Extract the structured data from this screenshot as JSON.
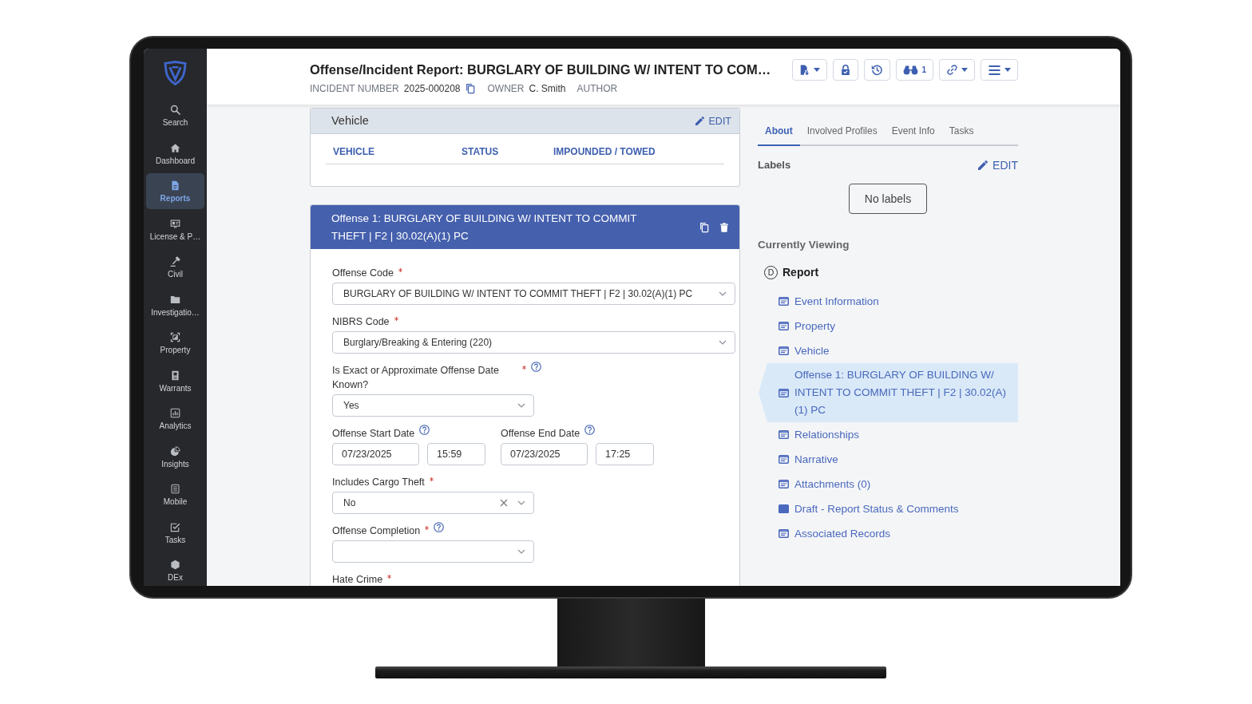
{
  "sidebar": {
    "items": [
      {
        "label": "Search",
        "selected": false
      },
      {
        "label": "Dashboard",
        "selected": false
      },
      {
        "label": "Reports",
        "selected": true
      },
      {
        "label": "License & P…",
        "selected": false
      },
      {
        "label": "Civil",
        "selected": false
      },
      {
        "label": "Investigatio…",
        "selected": false
      },
      {
        "label": "Property",
        "selected": false
      },
      {
        "label": "Warrants",
        "selected": false
      },
      {
        "label": "Analytics",
        "selected": false
      },
      {
        "label": "Insights",
        "selected": false
      },
      {
        "label": "Mobile",
        "selected": false
      },
      {
        "label": "Tasks",
        "selected": false
      },
      {
        "label": "DEx",
        "selected": false
      }
    ]
  },
  "header": {
    "title": "Offense/Incident Report: BURGLARY OF BUILDING W/ INTENT TO COM…",
    "meta": [
      {
        "label": "INCIDENT NUMBER",
        "value": "2025-000208",
        "copyable": true
      },
      {
        "label": "OWNER",
        "value": "C. Smith",
        "copyable": false
      },
      {
        "label": "AUTHOR",
        "copyable": false
      }
    ],
    "toolbar": [
      {
        "caret": true
      },
      {
        "caret": false
      },
      {
        "caret": false
      },
      {
        "count": "1",
        "caret": false
      },
      {
        "caret": true
      },
      {
        "caret": true
      }
    ]
  },
  "vehicle_card": {
    "title": "Vehicle",
    "edit": "EDIT",
    "columns": [
      "VEHICLE",
      "STATUS",
      "IMPOUNDED / TOWED"
    ]
  },
  "offense_card": {
    "title": "Offense 1: BURGLARY OF BUILDING W/ INTENT TO COMMIT THEFT | F2 | 30.02(A)(1) PC",
    "codes": [
      {
        "label": "Offense Code",
        "required": true,
        "help": false,
        "value": "BURGLARY OF BUILDING W/ INTENT TO COMMIT THEFT | F2 | 30.02(A)(1) PC"
      },
      {
        "label": "NIBRS Code",
        "required": true,
        "help": false,
        "value": "Burglary/Breaking & Entering (220)"
      }
    ],
    "fields": [
      {
        "kind": "select",
        "label": "Is Exact or Approximate Offense Date Known?",
        "required": true,
        "help": true,
        "value": "Yes",
        "clearable": false
      },
      {
        "kind": "datetimes",
        "items": [
          {
            "label": "Offense Start Date",
            "help": true,
            "date": "07/23/2025",
            "time": "15:59"
          },
          {
            "label": "Offense End Date",
            "help": true,
            "date": "07/23/2025",
            "time": "17:25"
          }
        ]
      },
      {
        "kind": "select",
        "label": "Includes Cargo Theft",
        "required": true,
        "help": false,
        "value": "No",
        "clearable": true
      },
      {
        "kind": "select",
        "label": "Offense Completion",
        "required": true,
        "help": true,
        "clearable": false
      },
      {
        "kind": "heading",
        "label": "Hate Crime",
        "required": true,
        "help": false
      }
    ]
  },
  "side_panel": {
    "tabs": [
      {
        "label": "About",
        "selected": true
      },
      {
        "label": "Involved Profiles",
        "selected": false
      },
      {
        "label": "Event Info",
        "selected": false
      },
      {
        "label": "Tasks",
        "selected": false
      }
    ],
    "labels": {
      "title": "Labels",
      "edit": "EDIT",
      "empty": "No labels"
    },
    "currently_viewing": {
      "title": "Currently Viewing",
      "root": {
        "badge": "D",
        "label": "Report",
        "children": [
          {
            "kind": "section",
            "label": "Event Information",
            "selected": false
          },
          {
            "kind": "section",
            "label": "Property",
            "selected": false
          },
          {
            "kind": "section",
            "label": "Vehicle",
            "selected": false
          },
          {
            "kind": "section",
            "label": "Offense 1: BURGLARY OF BUILDING W/ INTENT TO COMMIT THEFT | F2 | 30.02(A)(1) PC",
            "selected": true
          },
          {
            "kind": "section",
            "label": "Relationships",
            "selected": false
          },
          {
            "kind": "section",
            "label": "Narrative",
            "selected": false
          },
          {
            "kind": "section",
            "label": "Attachments (0)",
            "selected": false
          },
          {
            "kind": "status",
            "label": "Draft - Report Status & Comments",
            "selected": false
          },
          {
            "kind": "section",
            "label": "Associated Records",
            "selected": false
          }
        ]
      }
    }
  }
}
